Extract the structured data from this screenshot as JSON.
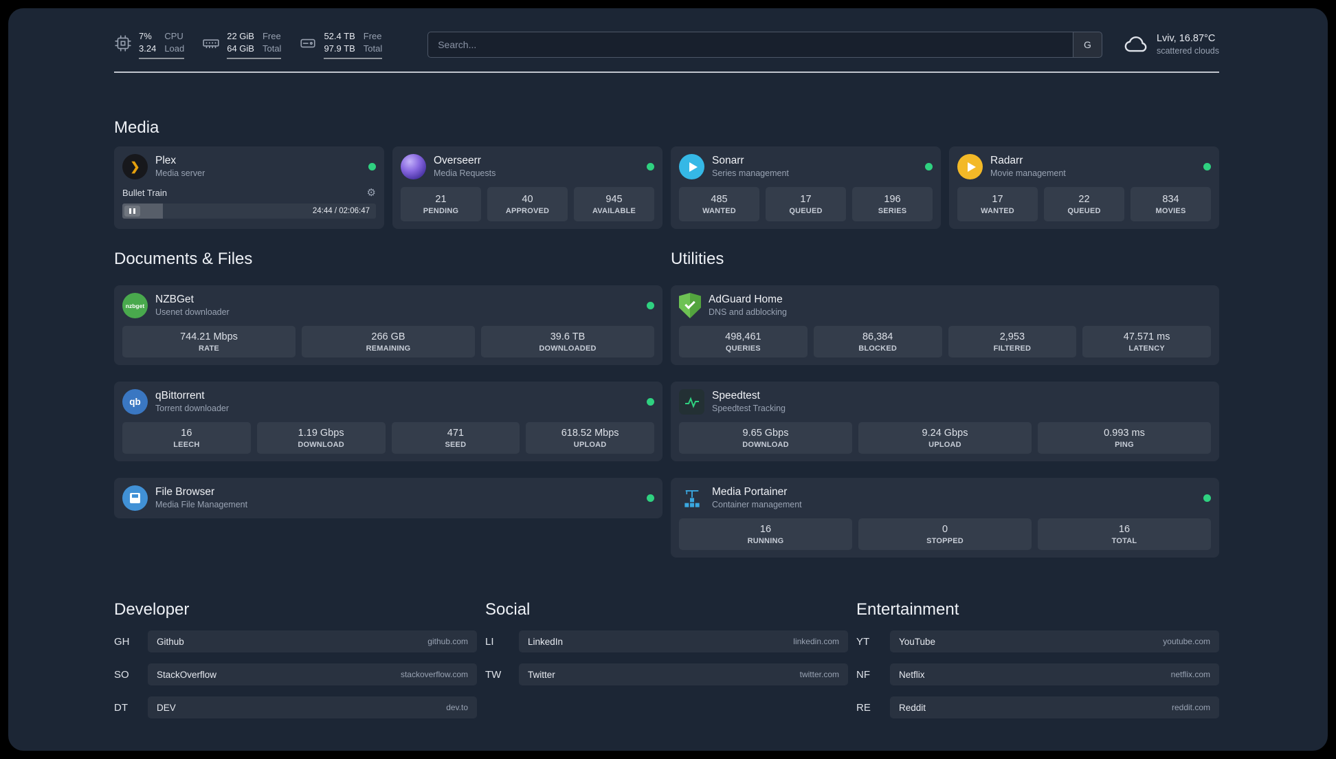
{
  "header": {
    "cpu": {
      "value1": "7%",
      "value2": "3.24",
      "label1": "CPU",
      "label2": "Load"
    },
    "memory": {
      "value1": "22 GiB",
      "value2": "64 GiB",
      "label1": "Free",
      "label2": "Total"
    },
    "disk": {
      "value1": "52.4 TB",
      "value2": "97.9 TB",
      "label1": "Free",
      "label2": "Total"
    },
    "search": {
      "placeholder": "Search...",
      "button_label": "G"
    },
    "weather": {
      "location": "Lviv, 16.87°C",
      "condition": "scattered clouds"
    }
  },
  "sections": {
    "media_title": "Media",
    "documents_title": "Documents & Files",
    "utilities_title": "Utilities",
    "developer_title": "Developer",
    "social_title": "Social",
    "entertainment_title": "Entertainment"
  },
  "services": {
    "plex": {
      "name": "Plex",
      "desc": "Media server",
      "now_playing": "Bullet Train",
      "time": "24:44 / 02:06:47"
    },
    "overseerr": {
      "name": "Overseerr",
      "desc": "Media Requests",
      "stats": [
        {
          "value": "21",
          "label": "PENDING"
        },
        {
          "value": "40",
          "label": "APPROVED"
        },
        {
          "value": "945",
          "label": "AVAILABLE"
        }
      ]
    },
    "sonarr": {
      "name": "Sonarr",
      "desc": "Series management",
      "stats": [
        {
          "value": "485",
          "label": "WANTED"
        },
        {
          "value": "17",
          "label": "QUEUED"
        },
        {
          "value": "196",
          "label": "SERIES"
        }
      ]
    },
    "radarr": {
      "name": "Radarr",
      "desc": "Movie management",
      "stats": [
        {
          "value": "17",
          "label": "WANTED"
        },
        {
          "value": "22",
          "label": "QUEUED"
        },
        {
          "value": "834",
          "label": "MOVIES"
        }
      ]
    },
    "nzbget": {
      "name": "NZBGet",
      "desc": "Usenet downloader",
      "stats": [
        {
          "value": "744.21 Mbps",
          "label": "RATE"
        },
        {
          "value": "266 GB",
          "label": "REMAINING"
        },
        {
          "value": "39.6 TB",
          "label": "DOWNLOADED"
        }
      ]
    },
    "qbittorrent": {
      "name": "qBittorrent",
      "desc": "Torrent downloader",
      "stats": [
        {
          "value": "16",
          "label": "LEECH"
        },
        {
          "value": "1.19 Gbps",
          "label": "DOWNLOAD"
        },
        {
          "value": "471",
          "label": "SEED"
        },
        {
          "value": "618.52 Mbps",
          "label": "UPLOAD"
        }
      ]
    },
    "filebrowser": {
      "name": "File Browser",
      "desc": "Media File Management"
    },
    "adguard": {
      "name": "AdGuard Home",
      "desc": "DNS and adblocking",
      "stats": [
        {
          "value": "498,461",
          "label": "QUERIES"
        },
        {
          "value": "86,384",
          "label": "BLOCKED"
        },
        {
          "value": "2,953",
          "label": "FILTERED"
        },
        {
          "value": "47.571 ms",
          "label": "LATENCY"
        }
      ]
    },
    "speedtest": {
      "name": "Speedtest",
      "desc": "Speedtest Tracking",
      "stats": [
        {
          "value": "9.65 Gbps",
          "label": "DOWNLOAD"
        },
        {
          "value": "9.24 Gbps",
          "label": "UPLOAD"
        },
        {
          "value": "0.993 ms",
          "label": "PING"
        }
      ]
    },
    "portainer": {
      "name": "Media Portainer",
      "desc": "Container management",
      "stats": [
        {
          "value": "16",
          "label": "RUNNING"
        },
        {
          "value": "0",
          "label": "STOPPED"
        },
        {
          "value": "16",
          "label": "TOTAL"
        }
      ]
    }
  },
  "bookmarks": {
    "developer": [
      {
        "abbr": "GH",
        "name": "Github",
        "domain": "github.com"
      },
      {
        "abbr": "SO",
        "name": "StackOverflow",
        "domain": "stackoverflow.com"
      },
      {
        "abbr": "DT",
        "name": "DEV",
        "domain": "dev.to"
      }
    ],
    "social": [
      {
        "abbr": "LI",
        "name": "LinkedIn",
        "domain": "linkedin.com"
      },
      {
        "abbr": "TW",
        "name": "Twitter",
        "domain": "twitter.com"
      }
    ],
    "entertainment": [
      {
        "abbr": "YT",
        "name": "YouTube",
        "domain": "youtube.com"
      },
      {
        "abbr": "NF",
        "name": "Netflix",
        "domain": "netflix.com"
      },
      {
        "abbr": "RE",
        "name": "Reddit",
        "domain": "reddit.com"
      }
    ]
  },
  "icons": {
    "gear": "⚙",
    "plex_chevron": "❯",
    "nzbget_text": "nzbget",
    "qbittorrent_text": "qb"
  },
  "colors": {
    "status_online": "#2fd180",
    "plex_accent": "#e5a00d"
  }
}
